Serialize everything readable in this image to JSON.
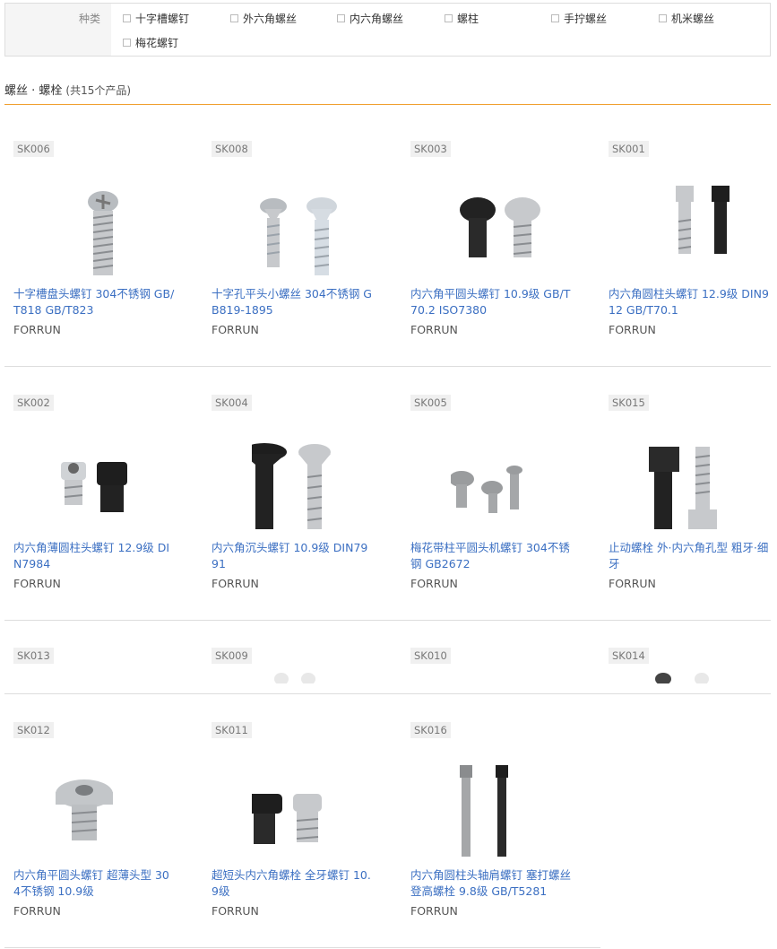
{
  "filter": {
    "label": "种类",
    "options": [
      "十字槽螺钉",
      "外六角螺丝",
      "内六角螺丝",
      "螺柱",
      "手拧螺丝",
      "机米螺丝",
      "梅花螺钉"
    ]
  },
  "category": {
    "title": "螺丝 · 螺栓",
    "count": "(共15个产品)"
  },
  "products": [
    {
      "sku": "SK006",
      "name": "十字槽盘头螺钉 304不锈钢 GB/T818 GB/T823",
      "brand": "FORRUN"
    },
    {
      "sku": "SK008",
      "name": "十字孔平头小螺丝 304不锈钢 GB819-1895",
      "brand": "FORRUN"
    },
    {
      "sku": "SK003",
      "name": "内六角平圆头螺钉 10.9级 GB/T70.2 ISO7380",
      "brand": "FORRUN"
    },
    {
      "sku": "SK001",
      "name": "内六角圆柱头螺钉 12.9级 DIN912 GB/T70.1",
      "brand": "FORRUN"
    },
    {
      "sku": "SK002",
      "name": "内六角薄圆柱头螺钉 12.9级 DIN7984",
      "brand": "FORRUN"
    },
    {
      "sku": "SK004",
      "name": "内六角沉头螺钉 10.9级 DIN7991",
      "brand": "FORRUN"
    },
    {
      "sku": "SK005",
      "name": "梅花带柱平圆头机螺钉 304不锈钢 GB2672",
      "brand": "FORRUN"
    },
    {
      "sku": "SK015",
      "name": "止动螺栓 外·内六角孔型 粗牙·细牙",
      "brand": "FORRUN"
    },
    {
      "sku": "SK012",
      "name": "内六角平圆头螺钉 超薄头型 304不锈钢 10.9级",
      "brand": "FORRUN"
    },
    {
      "sku": "SK011",
      "name": "超短头内六角螺栓 全牙螺钉 10.9级",
      "brand": "FORRUN"
    },
    {
      "sku": "SK016",
      "name": "内六角圆柱头轴肩螺钉 塞打螺丝 登高螺栓 9.8级 GB/T5281",
      "brand": "FORRUN"
    }
  ],
  "partial_row": [
    "SK013",
    "SK009",
    "SK010",
    "SK014"
  ],
  "colors": {
    "link": "#3b6fc2",
    "accent_line": "#f0a030"
  }
}
